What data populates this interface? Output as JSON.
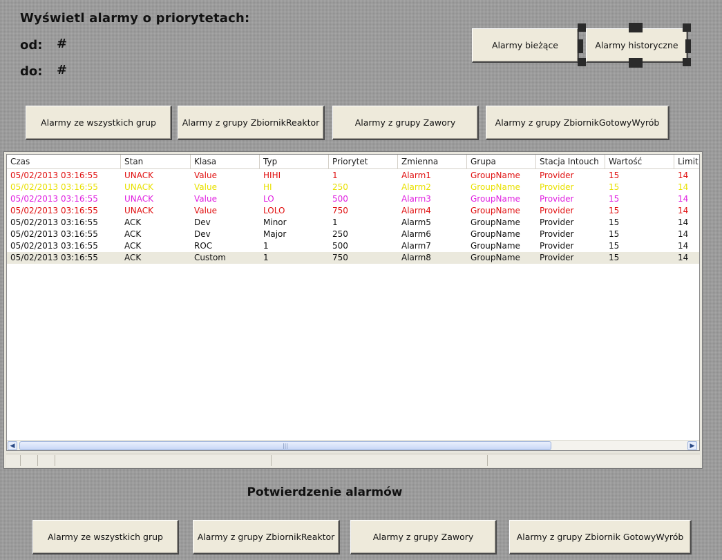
{
  "header": {
    "title": "Wyświetl alarmy o priorytetach:",
    "from_label": "od:",
    "from_value": "#",
    "to_label": "do:",
    "to_value": "#"
  },
  "view_buttons": {
    "current": "Alarmy bieżące",
    "historical": "Alarmy historyczne"
  },
  "filter_buttons": [
    "Alarmy ze wszystkich grup",
    "Alarmy z grupy ZbiornikReaktor",
    "Alarmy z grupy Zawory",
    "Alarmy z grupy ZbiornikGotowyWyrób"
  ],
  "table": {
    "columns": [
      "Czas",
      "Stan",
      "Klasa",
      "Typ",
      "Priorytet",
      "Zmienna",
      "Grupa",
      "Stacja Intouch",
      "Wartość",
      "Limit"
    ],
    "rows": [
      {
        "color": "#e01010",
        "selected": false,
        "cells": [
          "05/02/2013 03:16:55",
          "UNACK",
          "Value",
          "HIHI",
          "1",
          "Alarm1",
          "GroupName",
          "Provider",
          "15",
          "14"
        ]
      },
      {
        "color": "#e8e000",
        "selected": false,
        "cells": [
          "05/02/2013 03:16:55",
          "UNACK",
          "Value",
          "HI",
          "250",
          "Alarm2",
          "GroupName",
          "Provider",
          "15",
          "14"
        ]
      },
      {
        "color": "#e020e0",
        "selected": false,
        "cells": [
          "05/02/2013 03:16:55",
          "UNACK",
          "Value",
          "LO",
          "500",
          "Alarm3",
          "GroupName",
          "Provider",
          "15",
          "14"
        ]
      },
      {
        "color": "#e01010",
        "selected": false,
        "cells": [
          "05/02/2013 03:16:55",
          "UNACK",
          "Value",
          "LOLO",
          "750",
          "Alarm4",
          "GroupName",
          "Provider",
          "15",
          "14"
        ]
      },
      {
        "color": "#111111",
        "selected": false,
        "cells": [
          "05/02/2013 03:16:55",
          "ACK",
          "Dev",
          "Minor",
          "1",
          "Alarm5",
          "GroupName",
          "Provider",
          "15",
          "14"
        ]
      },
      {
        "color": "#111111",
        "selected": false,
        "cells": [
          "05/02/2013 03:16:55",
          "ACK",
          "Dev",
          "Major",
          "250",
          "Alarm6",
          "GroupName",
          "Provider",
          "15",
          "14"
        ]
      },
      {
        "color": "#111111",
        "selected": false,
        "cells": [
          "05/02/2013 03:16:55",
          "ACK",
          "ROC",
          "1",
          "500",
          "Alarm7",
          "GroupName",
          "Provider",
          "15",
          "14"
        ]
      },
      {
        "color": "#111111",
        "selected": true,
        "cells": [
          "05/02/2013 03:16:55",
          "ACK",
          "Custom",
          "1",
          "750",
          "Alarm8",
          "GroupName",
          "Provider",
          "15",
          "14"
        ]
      }
    ]
  },
  "scrollbar": {
    "left_icon": "scroll-left-icon",
    "right_icon": "scroll-right-icon",
    "grip_icon": "grip-icon"
  },
  "acknowledge": {
    "title": "Potwierdzenie alarmów",
    "buttons": [
      "Alarmy ze wszystkich grup",
      "Alarmy z grupy ZbiornikReaktor",
      "Alarmy z grupy Zawory",
      "Alarmy z grupy Zbiornik GotowyWyrób"
    ]
  }
}
